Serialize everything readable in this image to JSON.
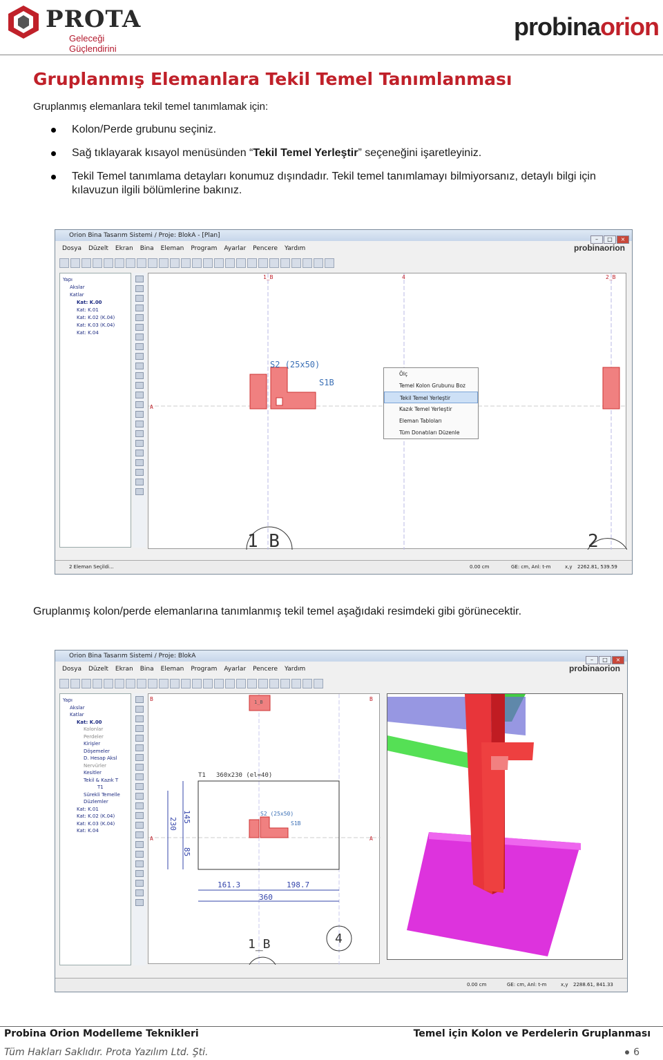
{
  "header": {
    "prota_name": "PROTA",
    "prota_tagline": "Geleceği Güçlendirini",
    "orion_brand_pre": "probina",
    "orion_brand_post": "orion"
  },
  "title": "Gruplanmış Elemanlara Tekil Temel Tanımlanması",
  "intro": "Gruplanmış elemanlara tekil temel tanımlamak için:",
  "bullets": [
    {
      "text": "Kolon/Perde grubunu seçiniz."
    },
    {
      "pre": "Sağ tıklayarak kısayol menüsünden “",
      "bold": "Tekil Temel Yerleştir",
      "post": "” seçeneğini işaretleyiniz."
    },
    {
      "text": "Tekil Temel tanımlama detayları konumuz dışındadır. Tekil temel tanımlamayı bilmiyorsanız, detaylı bilgi için kılavuzun ilgili bölümlerine bakınız."
    }
  ],
  "caption2": "Gruplanmış kolon/perde elemanlarına tanımlanmış tekil temel aşağıdaki resimdeki gibi görünecektir.",
  "screenshot1": {
    "window_title": "Orion Bina Tasarım Sistemi / Proje: BlokA - [Plan]",
    "menu": [
      "Dosya",
      "Düzelt",
      "Ekran",
      "Bina",
      "Eleman",
      "Program",
      "Ayarlar",
      "Pencere",
      "Yardım"
    ],
    "brand": "probinaorion",
    "tree": [
      "Yapı",
      "Akslar",
      "Katlar",
      "Kat: K.00",
      "Kat: K.01",
      "Kat: K.02 (K.04)",
      "Kat: K.03 (K.04)",
      "Kat: K.04"
    ],
    "labels": {
      "col": "S2 (25x50)",
      "col2": "S1B",
      "axis1": "1_B",
      "axis2": "2_",
      "ax_top1": "1_B",
      "ax_top2": "4",
      "ax_top3": "2_B",
      "ax_a": "A"
    },
    "context_menu": [
      "Ölç",
      "Temel Kolon Grubunu Boz",
      "Tekil Temel Yerleştir",
      "Kazık Temel Yerleştir",
      "Eleman Tabloları",
      "Tüm Donatıları Düzenle"
    ],
    "status": {
      "left": "2 Eleman Seçildi...",
      "mid1": "0.00 cm",
      "mid2": "GE: cm, Anl: t-m",
      "xy_label": "x,y",
      "xy": "2262.81, 539.59"
    }
  },
  "screenshot2": {
    "window_title": "Orion Bina Tasarım Sistemi / Proje: BlokA",
    "menu": [
      "Dosya",
      "Düzelt",
      "Ekran",
      "Bina",
      "Eleman",
      "Program",
      "Ayarlar",
      "Pencere",
      "Yardım"
    ],
    "brand": "probinaorion",
    "tree": [
      "Yapı",
      "Akslar",
      "Katlar",
      "Kat: K.00",
      "Kolonlar",
      "Perdeler",
      "Kirişler",
      "Döşemeler",
      "D. Hesap Aksl",
      "Nervürler",
      "Kesitler",
      "Tekil & Kazık T",
      "T1",
      "Sürekli Temelle",
      "Düzlemler",
      "Kat: K.01",
      "Kat: K.02 (K.04)",
      "Kat: K.03 (K.04)",
      "Kat: K.04"
    ],
    "labels": {
      "t1": "T1",
      "dims": "360x230 (el=40)",
      "col": "S2 (25x50)",
      "col2": "S1B",
      "d145": "145",
      "d230": "230",
      "d85": "85",
      "d1613": "161.3",
      "d1987": "198.7",
      "d360": "360",
      "axis1": "1_B",
      "axis4": "4",
      "ax_b": "B",
      "ax_a": "A",
      "top_tag": "1_B"
    },
    "status": {
      "mid1": "0.00 cm",
      "mid2": "GE: cm, Anl: t-m",
      "xy_label": "x,y",
      "xy": "2288.61, 841.33"
    }
  },
  "footer": {
    "left": "Probina Orion Modelleme Teknikleri",
    "right": "Temel için Kolon ve Perdelerin Gruplanması",
    "copyright": "Tüm Hakları Saklıdır. Prota Yazılım Ltd. Şti.",
    "page": "6"
  }
}
